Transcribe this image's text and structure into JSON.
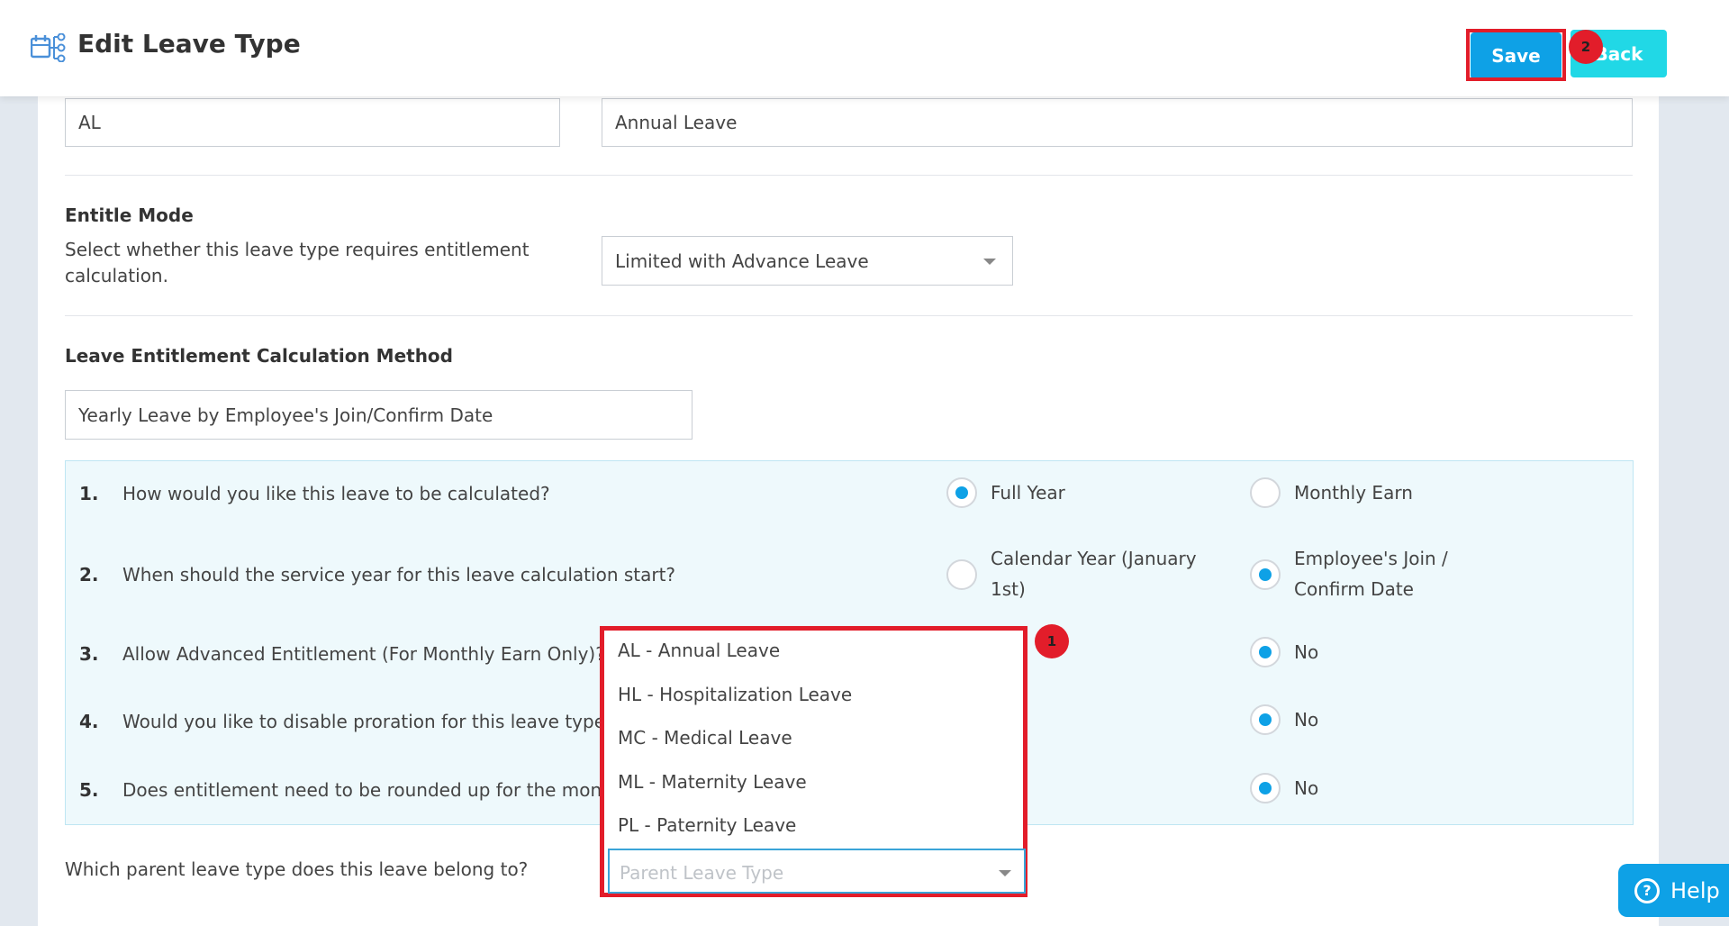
{
  "header": {
    "title": "Edit Leave Type",
    "icon": "leave-type-icon",
    "save_label": "Save",
    "back_label": "Back",
    "badges": [
      "1",
      "2"
    ]
  },
  "form": {
    "code_value": "AL",
    "name_value": "Annual Leave",
    "entitle_mode": {
      "heading": "Entitle Mode",
      "description": "Select whether this leave type requires entitlement calculation.",
      "selected": "Limited with Advance Leave"
    },
    "calc_method": {
      "heading": "Leave Entitlement Calculation Method",
      "selected": "Yearly Leave by Employee's Join/Confirm Date"
    },
    "questions": [
      {
        "num": "1.",
        "text": "How would you like this leave to be calculated?",
        "option_a": "Full Year",
        "option_b": "Monthly Earn",
        "selected": "Full Year"
      },
      {
        "num": "2.",
        "text": "When should the service year for this leave calculation start?",
        "option_a": "Calendar Year (January 1st)",
        "option_b": "Employee's Join / Confirm Date",
        "selected": "Employee's Join / Confirm Date"
      },
      {
        "num": "3.",
        "text": "Allow Advanced Entitlement (For Monthly Earn Only)?",
        "option_b": "No",
        "selected": "No"
      },
      {
        "num": "4.",
        "text": "Would you like to disable proration for this leave type?",
        "option_b": "No",
        "selected": "No"
      },
      {
        "num": "5.",
        "text": "Does entitlement need to be rounded up for the month o",
        "option_b": "No",
        "selected": "No"
      }
    ],
    "parent_leave": {
      "label": "Which parent leave type does this leave belong to?",
      "placeholder": "Parent Leave Type",
      "options": [
        "AL - Annual Leave",
        "HL - Hospitalization Leave",
        "MC - Medical Leave",
        "ML - Maternity Leave",
        "PL - Paternity Leave"
      ]
    }
  },
  "help": {
    "label": "Help"
  },
  "colors": {
    "accent": "#0ea1e6",
    "back": "#21d8e6",
    "highlight": "#e21d2a",
    "panel": "#eef9fc"
  }
}
